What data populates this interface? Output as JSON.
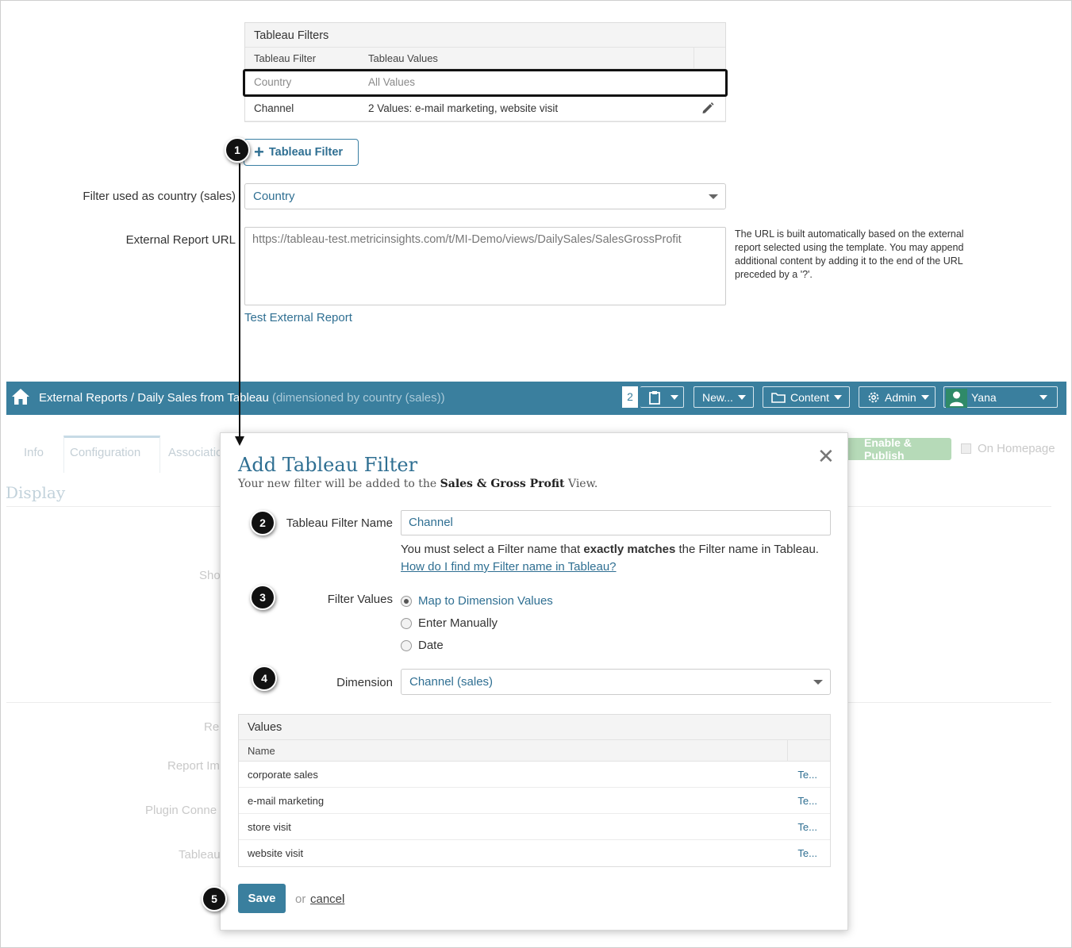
{
  "tableau_filters": {
    "title": "Tableau Filters",
    "columns": [
      "Tableau Filter",
      "Tableau Values"
    ],
    "rows": [
      {
        "filter": "Country",
        "values": "All Values"
      },
      {
        "filter": "Channel",
        "values": "2 Values: e-mail marketing, website visit"
      }
    ],
    "add_button_label": "Tableau Filter"
  },
  "form": {
    "country_filter_label": "Filter used as country (sales)",
    "country_filter_value": "Country",
    "url_label": "External Report URL",
    "url_value": "https://tableau-test.metricinsights.com/t/MI-Demo/views/DailySales/SalesGrossProfit",
    "url_help": "The URL is built automatically based on the external report selected using the template. You may append additional content by adding it to the end of the URL preceded by a '?'.",
    "test_link": "Test External Report"
  },
  "navbar": {
    "crumb_section": "External Reports",
    "crumb_sep": " / ",
    "crumb_page": "Daily Sales from Tableau",
    "crumb_muted": " (dimensioned by country (sales))",
    "count": "2",
    "new_label": "New...",
    "content_label": "Content",
    "admin_label": "Admin",
    "user_label": "Yana",
    "accent": "#3a7f9e"
  },
  "background_page": {
    "tabs": [
      "Info",
      "Configuration",
      "Associatio"
    ],
    "section_title": "Display",
    "fragments": [
      "Sho",
      "Re",
      "Report Im",
      "Plugin Conne",
      "Tableau"
    ],
    "enable_publish": "Enable & Publish",
    "on_homepage": "On Homepage"
  },
  "modal": {
    "title": "Add Tableau Filter",
    "subtitle_pre": "Your new filter will be added to the ",
    "subtitle_view": "Sales & Gross Profit",
    "subtitle_post": " View.",
    "filter_name_label": "Tableau Filter Name",
    "filter_name_value": "Channel",
    "help_pre": "You must select a Filter name that ",
    "help_bold": "exactly matches",
    "help_mid": " the Filter name in Tableau. ",
    "help_link": "How do I find my Filter name in Tableau?",
    "filter_values_label": "Filter Values",
    "radio_options": [
      "Map to Dimension Values",
      "Enter Manually",
      "Date"
    ],
    "selected_option": "Map to Dimension Values",
    "dimension_label": "Dimension",
    "dimension_value": "Channel (sales)",
    "values_table": {
      "title": "Values",
      "column": "Name",
      "rows": [
        {
          "name": "corporate sales",
          "action": "Te..."
        },
        {
          "name": "e-mail marketing",
          "action": "Te..."
        },
        {
          "name": "store visit",
          "action": "Te..."
        },
        {
          "name": "website visit",
          "action": "Te..."
        }
      ]
    },
    "save_label": "Save",
    "or_text": "or",
    "cancel_label": "cancel"
  },
  "callouts": [
    "1",
    "2",
    "3",
    "4",
    "5"
  ]
}
